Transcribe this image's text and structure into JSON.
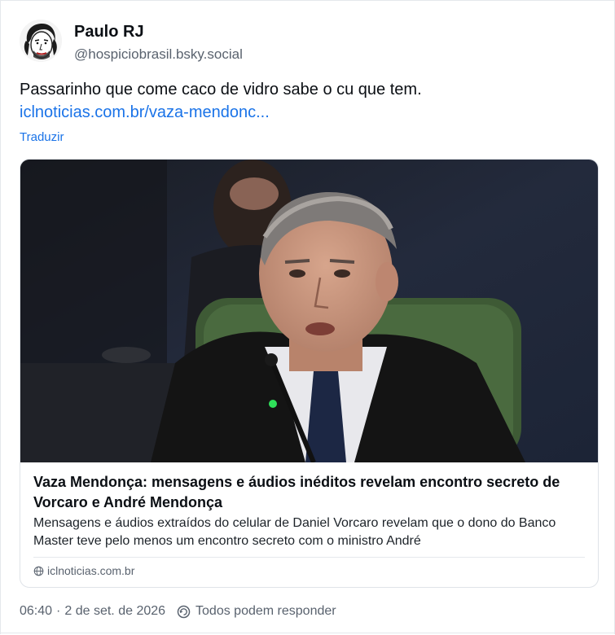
{
  "author": {
    "display_name": "Paulo RJ",
    "handle": "@hospiciobrasil.bsky.social"
  },
  "post": {
    "text": "Passarinho que come caco de vidro sabe o cu que tem.",
    "link_text": "iclnoticias.com.br/vaza-mendonc...",
    "translate_label": "Traduzir"
  },
  "link_card": {
    "title": "Vaza Mendonça: mensagens e áudios inéditos revelam encontro secreto de Vorcaro e André Mendonça",
    "description": "Mensagens e áudios extraídos do celular de Daniel Vorcaro revelam que o dono do Banco Master teve pelo menos um encontro secreto com o ministro André",
    "domain": "iclnoticias.com.br"
  },
  "meta": {
    "time": "06:40",
    "separator": "·",
    "date": "2 de set. de 2026",
    "reply_setting": "Todos podem responder"
  },
  "colors": {
    "link": "#1a73e8",
    "text": "#0b0f14",
    "muted": "#59626e",
    "border": "#dfe3e8"
  }
}
